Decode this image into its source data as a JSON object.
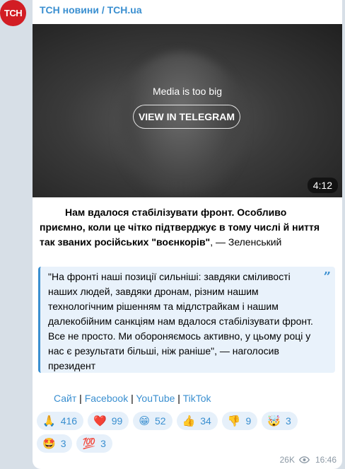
{
  "channel": {
    "avatar_text": "ТСН",
    "title": "ТСН новини / TCH.ua"
  },
  "video": {
    "note": "Media is too big",
    "button_label": "VIEW IN TELEGRAM",
    "duration": "4:12"
  },
  "caption": {
    "bold_text": "Нам вдалося стабілізувати фронт. Особливо приємно, коли це чітко підтверджує в тому числі й ниття так званих російських \"воєнкорів\"",
    "tail_text": ", — Зеленський"
  },
  "quote": {
    "text": "\"На фронті наші позиції сильніші: завдяки сміливості наших людей, завдяки дронам, різним нашим технологічним рішенням та мідлстрайкам і нашим далекобійним санкціям нам вдалося стабілізувати фронт. Все не просто. Ми обороняємось активно, у цьому році у нас є результати більші, ніж раніше\", — наголосив президент",
    "icon": "quote-icon"
  },
  "links": {
    "site": "Сайт",
    "sep1": " | ",
    "facebook": "Facebook",
    "sep2": " | ",
    "youtube": "YouTube",
    "sep3": " | ",
    "tiktok": "TikTok"
  },
  "reactions": [
    {
      "emoji": "🙏",
      "count": "416"
    },
    {
      "emoji": "❤️",
      "count": "99"
    },
    {
      "emoji": "😁",
      "count": "52"
    },
    {
      "emoji": "👍",
      "count": "34"
    },
    {
      "emoji": "👎",
      "count": "9"
    },
    {
      "emoji": "🤯",
      "count": "3"
    },
    {
      "emoji": "🤩",
      "count": "3"
    },
    {
      "emoji": "💯",
      "count": "3"
    }
  ],
  "meta": {
    "views": "26K",
    "time": "16:46"
  },
  "colors": {
    "accent": "#3a8fd0",
    "avatar_bg": "#d21d24",
    "background": "#d7dfe7"
  }
}
